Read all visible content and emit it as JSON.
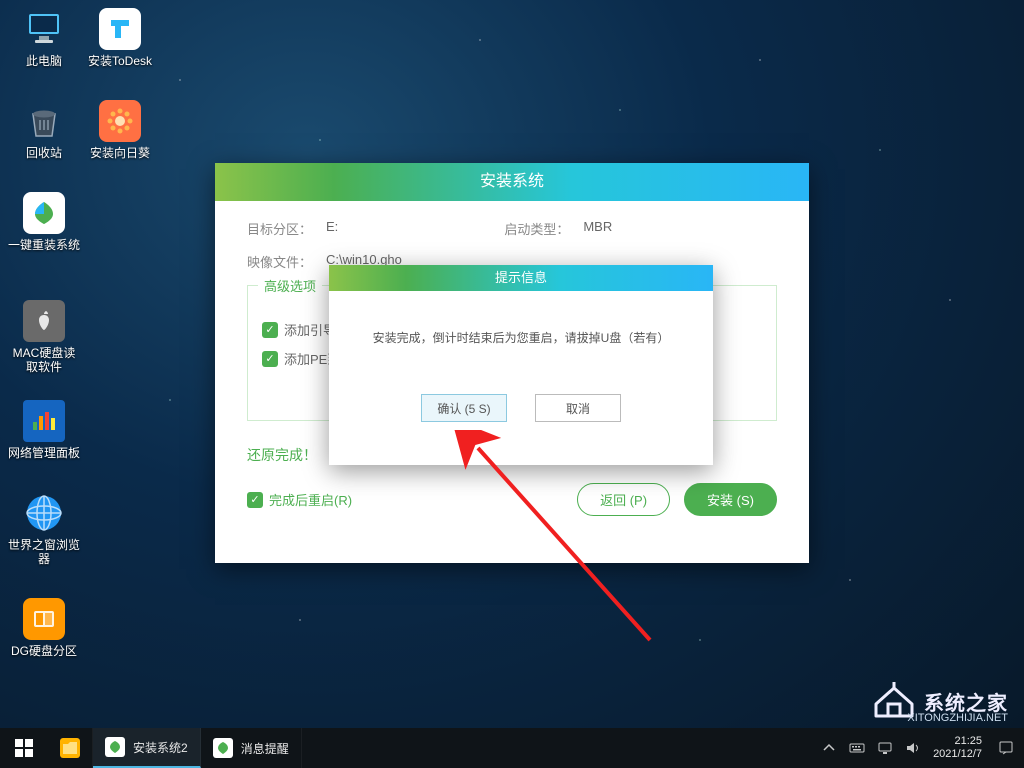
{
  "desktop_icons": [
    {
      "label": "此电脑",
      "slot": "pc"
    },
    {
      "label": "安装ToDesk",
      "slot": "todesk"
    },
    {
      "label": "回收站",
      "slot": "recycle"
    },
    {
      "label": "安装向日葵",
      "slot": "sunflower"
    },
    {
      "label": "一键重装系统",
      "slot": "reinstall"
    },
    {
      "label": "MAC硬盘读取软件",
      "slot": "macdisk"
    },
    {
      "label": "网络管理面板",
      "slot": "netpanel"
    },
    {
      "label": "世界之窗浏览器",
      "slot": "browser"
    },
    {
      "label": "DG硬盘分区",
      "slot": "dg"
    }
  ],
  "installer": {
    "title": "安装系统",
    "target_label": "目标分区：",
    "target_value": "E:",
    "boot_label": "启动类型：",
    "boot_value": "MBR",
    "image_label": "映像文件：",
    "image_value": "C:\\win10.gho",
    "adv_title": "高级选项",
    "chk1": "添加引导",
    "chk2": "添加PE到启动菜单",
    "restore_done": "还原完成！",
    "restart_label": "完成后重启(R)",
    "btn_back": "返回 (P)",
    "btn_install": "安装 (S)"
  },
  "modal": {
    "title": "提示信息",
    "message": "安装完成，倒计时结束后为您重启，请拔掉U盘（若有）",
    "confirm": "确认 (5 S)",
    "cancel": "取消"
  },
  "watermark": {
    "text": "系统之家",
    "url": "XITONGZHIJIA.NET"
  },
  "taskbar": {
    "task1": "安装系统2",
    "task2": "消息提醒",
    "time": "21:25",
    "date": "2021/12/7"
  }
}
